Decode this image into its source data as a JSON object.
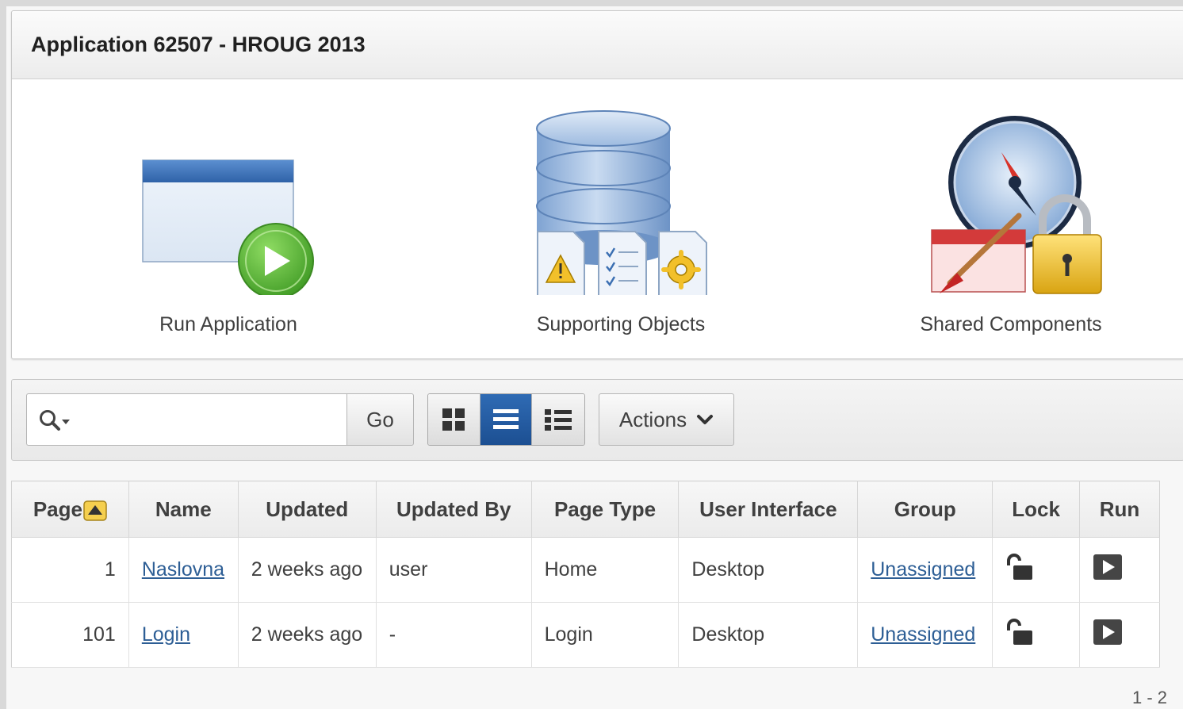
{
  "region": {
    "title": "Application 62507 - HROUG 2013",
    "tiles": [
      {
        "label": "Run Application",
        "icon": "run-application-icon"
      },
      {
        "label": "Supporting Objects",
        "icon": "supporting-objects-icon"
      },
      {
        "label": "Shared Components",
        "icon": "shared-components-icon"
      }
    ]
  },
  "toolbar": {
    "search_value": "",
    "go_label": "Go",
    "view_mode": "list",
    "actions_label": "Actions"
  },
  "report": {
    "columns": [
      "Page",
      "Name",
      "Updated",
      "Updated By",
      "Page Type",
      "User Interface",
      "Group",
      "Lock",
      "Run"
    ],
    "sort_column": "Page",
    "sort_direction": "ascending",
    "rows": [
      {
        "page": "1",
        "name": "Naslovna",
        "updated": "2 weeks ago",
        "updated_by": "user",
        "page_type": "Home",
        "ui": "Desktop",
        "group": "Unassigned"
      },
      {
        "page": "101",
        "name": "Login",
        "updated": "2 weeks ago",
        "updated_by": "-",
        "page_type": "Login",
        "ui": "Desktop",
        "group": "Unassigned"
      }
    ],
    "pagination": "1 - 2"
  },
  "colors": {
    "accent": "#1c4f92",
    "link": "#2d5e95",
    "run_green": "#5cb030"
  }
}
